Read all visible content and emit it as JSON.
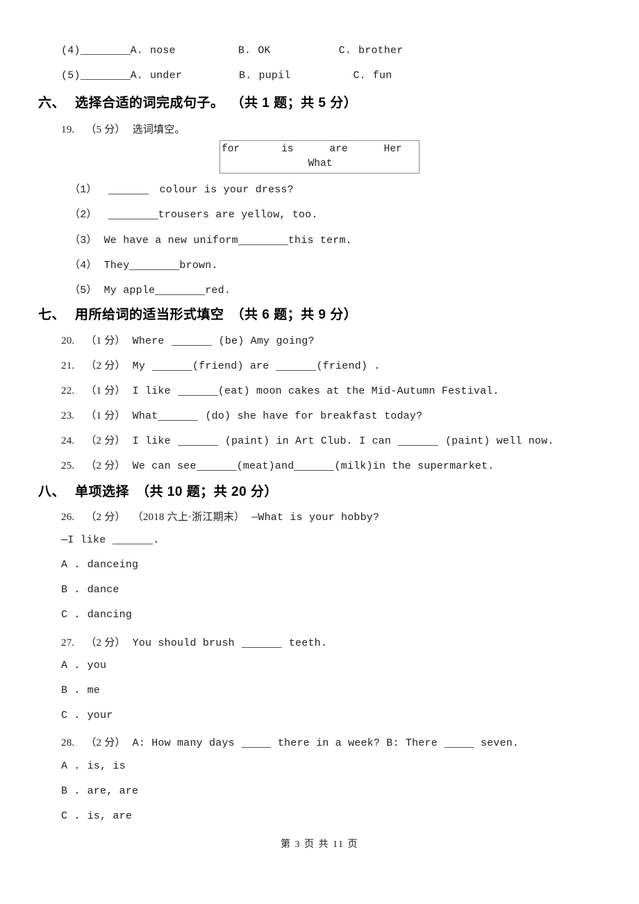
{
  "document": {
    "page_footer": "第 3 页 共 11 页",
    "page_number": "3",
    "total_pages": "11"
  },
  "top_carryover": {
    "items": [
      {
        "label": "(4)",
        "options": [
          {
            "letter": "A.",
            "text": "nose"
          },
          {
            "letter": "B.",
            "text": "OK"
          },
          {
            "letter": "C.",
            "text": "brother"
          }
        ]
      },
      {
        "label": "(5)",
        "options": [
          {
            "letter": "A.",
            "text": "under"
          },
          {
            "letter": "B.",
            "text": "pupil"
          },
          {
            "letter": "C.",
            "text": "fun"
          }
        ]
      }
    ]
  },
  "sections": [
    {
      "number": "六、",
      "title": "选择合适的词完成句子。",
      "meta": "（共 1 题；共 5 分）"
    },
    {
      "number": "七、",
      "title": "用所给词的适当形式填空",
      "meta": "（共 6 题；共 9 分）"
    },
    {
      "number": "八、",
      "title": "单项选择",
      "meta": "（共 10 题；共 20 分）"
    }
  ],
  "question19": {
    "number": "19.",
    "score": "（5 分）",
    "prompt": "选词填空。",
    "word_bank": [
      "for",
      "is",
      "are",
      "Her",
      "What"
    ],
    "sub_items": [
      {
        "label": "（1）",
        "before": "",
        "after": "colour is your dress?"
      },
      {
        "label": "（2）",
        "before": "",
        "after": "trousers are yellow, too."
      },
      {
        "label": "（3）",
        "before": "We have a new uniform",
        "after": "this term."
      },
      {
        "label": "（4）",
        "before": "They",
        "after": "brown."
      },
      {
        "label": "（5）",
        "before": "My apple",
        "after": "red."
      }
    ]
  },
  "fill_in_questions": [
    {
      "number": "20.",
      "score": "（1 分）",
      "part1": "Where",
      "part2": "(be) Amy going?"
    },
    {
      "number": "21.",
      "score": "（2 分）",
      "part1": "My",
      "part2": "(friend) are",
      "part3": "(friend) ."
    },
    {
      "number": "22.",
      "score": "（1 分）",
      "part1": "I like",
      "part2": "(eat) moon cakes at the Mid-Autumn Festival."
    },
    {
      "number": "23.",
      "score": "（1 分）",
      "part1": "What",
      "part2": "(do) she have for breakfast today?"
    },
    {
      "number": "24.",
      "score": "（2 分）",
      "part1": "I like",
      "part2": "(paint) in Art Club. I can",
      "part3": "(paint) well now."
    },
    {
      "number": "25.",
      "score": "（2 分）",
      "part1": "We can see",
      "part2": "(meat)and",
      "part3": "(milk)in the supermarket."
    }
  ],
  "choice_questions": [
    {
      "number": "26.",
      "score": "（2 分）",
      "tag": "（2018 六上·浙江期末）",
      "stem": "—What is your hobby?",
      "stem_line2_before": "—I like",
      "stem_line2_after": ".",
      "options": [
        {
          "letter": "A .",
          "text": "danceing"
        },
        {
          "letter": "B .",
          "text": "dance"
        },
        {
          "letter": "C .",
          "text": "dancing"
        }
      ]
    },
    {
      "number": "27.",
      "score": "（2 分）",
      "stem_before": "You should brush",
      "stem_after": "teeth.",
      "options": [
        {
          "letter": "A .",
          "text": "you"
        },
        {
          "letter": "B .",
          "text": "me"
        },
        {
          "letter": "C .",
          "text": "your"
        }
      ]
    },
    {
      "number": "28.",
      "score": "（2 分）",
      "stem_p1": "A: How many days",
      "stem_p2": "there in a week? B: There",
      "stem_p3": "seven.",
      "options": [
        {
          "letter": "A .",
          "text": "is, is"
        },
        {
          "letter": "B .",
          "text": "are, are"
        },
        {
          "letter": "C .",
          "text": "is, are"
        }
      ]
    }
  ]
}
